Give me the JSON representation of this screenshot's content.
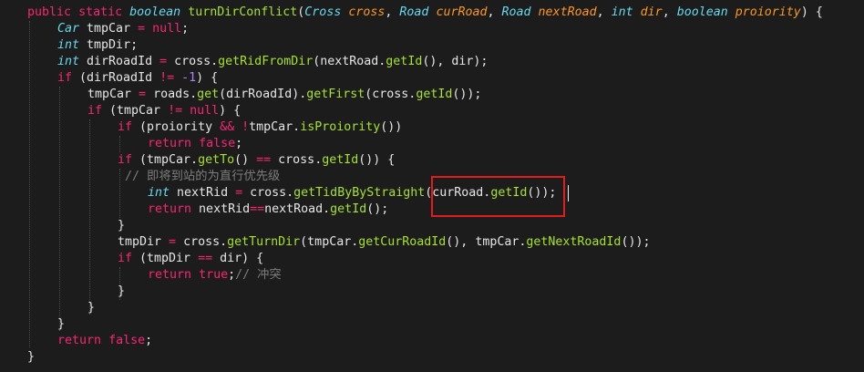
{
  "code_editor": {
    "lines": [
      [
        [
          "kw",
          "public"
        ],
        [
          "pl",
          " "
        ],
        [
          "kw",
          "static"
        ],
        [
          "pl",
          " "
        ],
        [
          "ty",
          "boolean"
        ],
        [
          "pl",
          " "
        ],
        [
          "fn",
          "turnDirConflict"
        ],
        [
          "pl",
          "("
        ],
        [
          "ty",
          "Cross"
        ],
        [
          "pl",
          " "
        ],
        [
          "pa",
          "cross"
        ],
        [
          "pl",
          ", "
        ],
        [
          "ty",
          "Road"
        ],
        [
          "pl",
          " "
        ],
        [
          "pa",
          "curRoad"
        ],
        [
          "pl",
          ", "
        ],
        [
          "ty",
          "Road"
        ],
        [
          "pl",
          " "
        ],
        [
          "pa",
          "nextRoad"
        ],
        [
          "pl",
          ", "
        ],
        [
          "ty",
          "int"
        ],
        [
          "pl",
          " "
        ],
        [
          "pa",
          "dir"
        ],
        [
          "pl",
          ", "
        ],
        [
          "ty",
          "boolean"
        ],
        [
          "pl",
          " "
        ],
        [
          "pa",
          "proiority"
        ],
        [
          "pl",
          ") {"
        ]
      ],
      [
        [
          "ty",
          "Car"
        ],
        [
          "pl",
          " tmpCar "
        ],
        [
          "op",
          "="
        ],
        [
          "pl",
          " "
        ],
        [
          "kw",
          "null"
        ],
        [
          "pl",
          ";"
        ]
      ],
      [
        [
          "ty",
          "int"
        ],
        [
          "pl",
          " tmpDir;"
        ]
      ],
      [
        [
          "ty",
          "int"
        ],
        [
          "pl",
          " dirRoadId "
        ],
        [
          "op",
          "="
        ],
        [
          "pl",
          " cross."
        ],
        [
          "fn",
          "getRidFromDir"
        ],
        [
          "pl",
          "(nextRoad."
        ],
        [
          "fn",
          "getId"
        ],
        [
          "pl",
          "(), dir);"
        ]
      ],
      [
        [
          "kw",
          "if"
        ],
        [
          "pl",
          " (dirRoadId "
        ],
        [
          "op",
          "!="
        ],
        [
          "pl",
          " "
        ],
        [
          "num",
          "-1"
        ],
        [
          "pl",
          ") {"
        ]
      ],
      [
        [
          "pl",
          "tmpCar "
        ],
        [
          "op",
          "="
        ],
        [
          "pl",
          " roads."
        ],
        [
          "fn",
          "get"
        ],
        [
          "pl",
          "(dirRoadId)."
        ],
        [
          "fn",
          "getFirst"
        ],
        [
          "pl",
          "(cross."
        ],
        [
          "fn",
          "getId"
        ],
        [
          "pl",
          "());"
        ]
      ],
      [
        [
          "kw",
          "if"
        ],
        [
          "pl",
          " (tmpCar "
        ],
        [
          "op",
          "!="
        ],
        [
          "pl",
          " "
        ],
        [
          "kw",
          "null"
        ],
        [
          "pl",
          ") {"
        ]
      ],
      [
        [
          "kw",
          "if"
        ],
        [
          "pl",
          " (proiority "
        ],
        [
          "op",
          "&&"
        ],
        [
          "pl",
          " "
        ],
        [
          "op",
          "!"
        ],
        [
          "pl",
          "tmpCar."
        ],
        [
          "fn",
          "isProiority"
        ],
        [
          "pl",
          "())"
        ]
      ],
      [
        [
          "kw",
          "return"
        ],
        [
          "pl",
          " "
        ],
        [
          "kw",
          "false"
        ],
        [
          "pl",
          ";"
        ]
      ],
      [
        [
          "kw",
          "if"
        ],
        [
          "pl",
          " (tmpCar."
        ],
        [
          "fn",
          "getTo"
        ],
        [
          "pl",
          "() "
        ],
        [
          "op",
          "=="
        ],
        [
          "pl",
          " cross."
        ],
        [
          "fn",
          "getId"
        ],
        [
          "pl",
          "()) {"
        ]
      ],
      [
        [
          "cm",
          "// 即将到站的为直行优先级"
        ]
      ],
      [
        [
          "ty",
          "int"
        ],
        [
          "pl",
          " nextRid "
        ],
        [
          "op",
          "="
        ],
        [
          "pl",
          " cross."
        ],
        [
          "fn",
          "getTidByByStraight"
        ],
        [
          "pl",
          "(curRoad."
        ],
        [
          "fn",
          "getId"
        ],
        [
          "pl",
          "());"
        ]
      ],
      [
        [
          "kw",
          "return"
        ],
        [
          "pl",
          " nextRid"
        ],
        [
          "op",
          "=="
        ],
        [
          "pl",
          "nextRoad."
        ],
        [
          "fn",
          "getId"
        ],
        [
          "pl",
          "();"
        ]
      ],
      [
        [
          "pl",
          "}"
        ]
      ],
      [
        [
          "pl",
          "tmpDir "
        ],
        [
          "op",
          "="
        ],
        [
          "pl",
          " cross."
        ],
        [
          "fn",
          "getTurnDir"
        ],
        [
          "pl",
          "(tmpCar."
        ],
        [
          "fn",
          "getCurRoadId"
        ],
        [
          "pl",
          "(), tmpCar."
        ],
        [
          "fn",
          "getNextRoadId"
        ],
        [
          "pl",
          "());"
        ]
      ],
      [
        [
          "kw",
          "if"
        ],
        [
          "pl",
          " (tmpDir "
        ],
        [
          "op",
          "=="
        ],
        [
          "pl",
          " dir) {"
        ]
      ],
      [
        [
          "kw",
          "return"
        ],
        [
          "pl",
          " "
        ],
        [
          "kw",
          "true"
        ],
        [
          "pl",
          ";"
        ],
        [
          "cm",
          "// 冲突"
        ]
      ],
      [
        [
          "pl",
          "}"
        ]
      ],
      [
        [
          "pl",
          "}"
        ]
      ],
      [
        [
          "pl",
          "}"
        ]
      ],
      [
        [
          "kw",
          "return"
        ],
        [
          "pl",
          " "
        ],
        [
          "kw",
          "false"
        ],
        [
          "pl",
          ";"
        ]
      ],
      [
        [
          "pl",
          "}"
        ]
      ]
    ]
  },
  "colors": {
    "background": "#1c1c1c",
    "keyword": "#f92672",
    "type": "#66d9ef",
    "function": "#a6e22e",
    "parameter": "#fd971f",
    "number": "#ae81ff",
    "comment": "#7d7d7d",
    "text": "#e6e6e6",
    "highlight_box": "#e21b1b"
  }
}
